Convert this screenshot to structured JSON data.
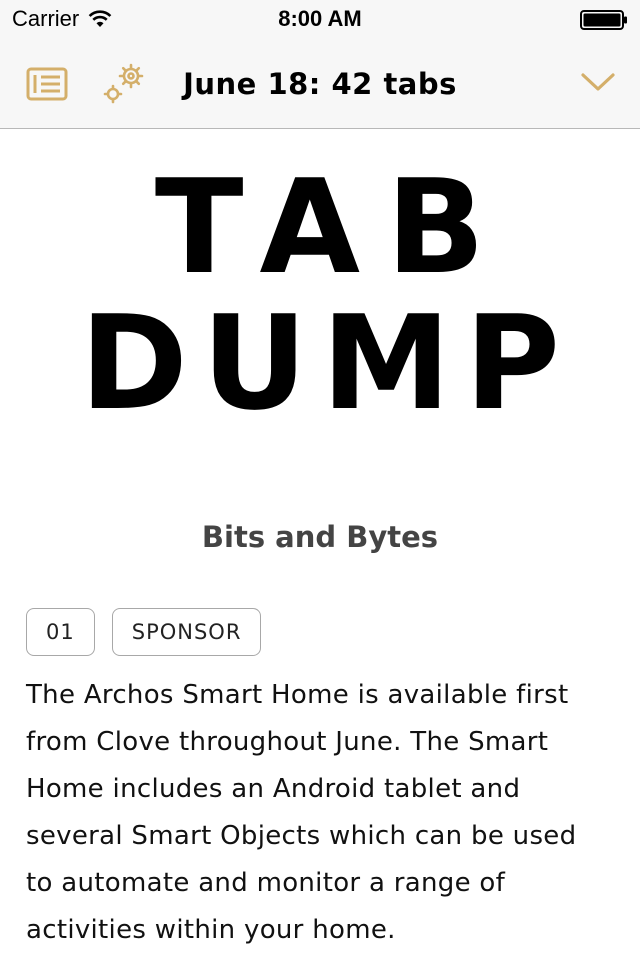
{
  "status_bar": {
    "carrier": "Carrier",
    "time": "8:00 AM"
  },
  "nav": {
    "title": "June 18: 42 tabs",
    "accent_color": "#D4AF6A",
    "icons": [
      "list-icon",
      "settings-gears-icon",
      "chevron-down-icon"
    ]
  },
  "logo": {
    "line1": "TAB",
    "line2": "DUMP"
  },
  "section": {
    "title": "Bits and Bytes"
  },
  "article": {
    "number": "01",
    "tag": "SPONSOR",
    "body": "The Archos Smart Home is available first from Clove throughout June. The Smart Home includes an Android tablet and several Smart Objects which can be used to automate and monitor a range of activities within your home."
  }
}
